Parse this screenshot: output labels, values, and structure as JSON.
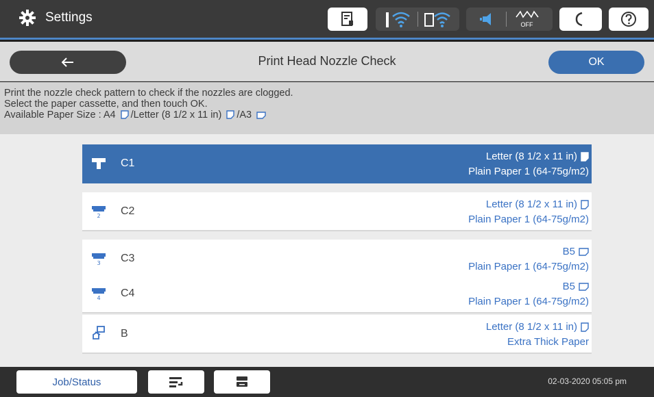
{
  "topbar": {
    "settings_label": "Settings",
    "settings_icon": "gear-icon",
    "status_icons": [
      "printer-status-icon",
      "wifi-icon",
      "wifi-direct-icon",
      "sound-icon",
      "eco-off-icon",
      "sleep-icon",
      "help-icon"
    ],
    "eco_label": "OFF"
  },
  "navbar": {
    "back_icon": "back-arrow-icon",
    "title": "Print Head Nozzle Check",
    "ok_label": "OK"
  },
  "info": {
    "line1": "Print the nozzle check pattern to check if the nozzles are clogged.",
    "line2": "Select the paper cassette, and then touch OK.",
    "line3_prefix": "Available Paper Size : A4",
    "line3_mid": "/Letter (8 1/2 x 11 in)",
    "line3_end": "/A3"
  },
  "sources": [
    {
      "name": "C1",
      "size": "Letter (8 1/2 x 11 in)",
      "paper": "Plain Paper 1 (64-75g/m2)",
      "selected": true
    },
    {
      "name": "C2",
      "size": "Letter (8 1/2 x 11 in)",
      "paper": "Plain Paper 1 (64-75g/m2)",
      "selected": false
    },
    {
      "name": "C3",
      "size": "B5",
      "paper": "Plain Paper 1 (64-75g/m2)",
      "selected": false
    },
    {
      "name": "C4",
      "size": "B5",
      "paper": "Plain Paper 1 (64-75g/m2)",
      "selected": false
    },
    {
      "name": "B",
      "size": "Letter (8 1/2 x 11 in)",
      "paper": "Extra Thick Paper",
      "selected": false
    }
  ],
  "bottombar": {
    "job_status_label": "Job/Status",
    "datetime": "02-03-2020 05:05 pm"
  },
  "colors": {
    "accent_blue": "#3a6fb0",
    "link_blue": "#3a72c4",
    "topbar_bg": "#3a3a3a"
  }
}
